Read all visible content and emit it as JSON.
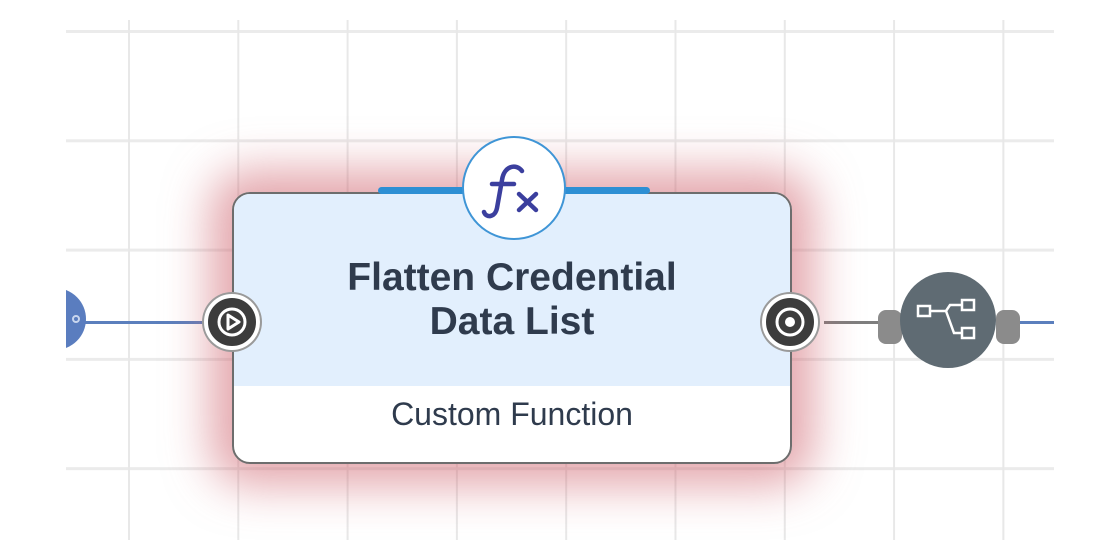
{
  "node": {
    "title": "Flatten Credential\nData List",
    "subtitle": "Custom Function",
    "icon": "fx-function-icon",
    "selected": true
  },
  "ports": {
    "input_icon": "play-circle-icon",
    "output_icon": "target-circle-icon"
  },
  "neighbors": {
    "previous_icon": "node-circle-icon",
    "next_icon": "flow-branch-icon"
  },
  "colors": {
    "header_fill": "#e2effd",
    "accent": "#2d8fd4",
    "selection_glow": "#cd5f69",
    "connector": "#5b7fbd",
    "next_node": "#5f6b73"
  }
}
